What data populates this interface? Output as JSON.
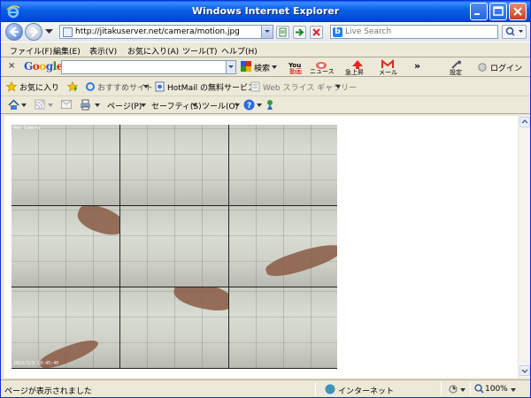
{
  "window": {
    "title": "Windows Internet Explorer"
  },
  "address": {
    "url": "http://jitakuserver.net/camera/motion.jpg"
  },
  "search": {
    "placeholder": "Live Search"
  },
  "menu": {
    "items": [
      "ファイル(F)",
      "編集(E)",
      "表示(V)",
      "お気に入り(A)",
      "ツール(T)",
      "ヘルプ(H)"
    ]
  },
  "google_bar": {
    "logo": "Google",
    "search_label": "検索",
    "you_tube_label": "動画",
    "news_label": "ニュース",
    "trending_label": "急上昇",
    "mail_label": "メール",
    "more_label": "»",
    "settings_label": "設定",
    "login_label": "ログイン"
  },
  "favorites_bar": {
    "favorites_label": "お気に入り",
    "items": [
      "おすすめサイト",
      "HotMail の無料サービス",
      "Web スライス ギャラリー"
    ]
  },
  "command_bar": {
    "page_label": "ページ(P)",
    "safety_label": "セーフティ(S)",
    "tools_label": "ツール(O)"
  },
  "camera": {
    "label": "Web Camera",
    "timestamp": "2013/3/9 10:45:40"
  },
  "status_bar": {
    "status_text": "ページが表示されました",
    "zone": "インターネット",
    "zoom": "100%"
  },
  "colors": {
    "titlebar": "#0A5FE9",
    "close_button": "#C8411C"
  }
}
